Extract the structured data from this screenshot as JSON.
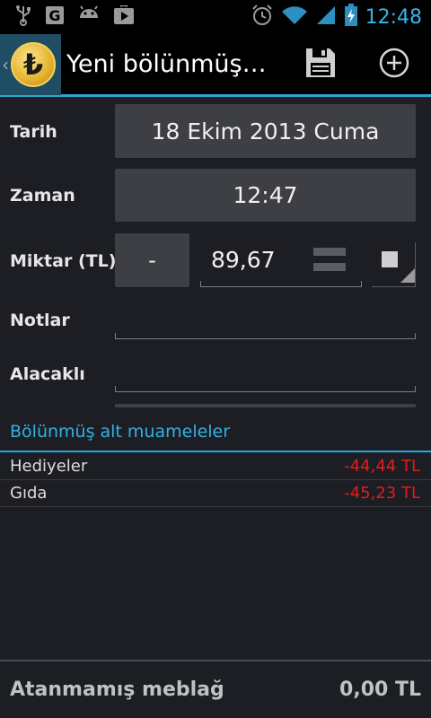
{
  "status_bar": {
    "time": "12:48",
    "icons": [
      "usb-icon",
      "g-icon",
      "android-icon",
      "play-store-icon",
      "alarm-icon",
      "wifi-icon",
      "signal-icon",
      "battery-charging-icon"
    ]
  },
  "action_bar": {
    "title": "Yeni bölünmüş…",
    "app_icon_glyph": "₺",
    "actions": [
      "save-icon",
      "add-icon"
    ]
  },
  "form": {
    "date_label": "Tarih",
    "date_value": "18 Ekim 2013 Cuma",
    "time_label": "Zaman",
    "time_value": "12:47",
    "amount_label": "Miktar (TL)",
    "amount_sign": "-",
    "amount_value": "89,67",
    "notes_label": "Notlar",
    "notes_value": "",
    "payee_label": "Alacaklı",
    "payee_value": ""
  },
  "splits": {
    "title": "Bölünmüş alt muameleler",
    "items": [
      {
        "name": "Hediyeler",
        "amount": "-44,44 TL"
      },
      {
        "name": "Gıda",
        "amount": "-45,23 TL"
      }
    ]
  },
  "footer": {
    "label": "Atanmamış meblağ",
    "value": "0,00 TL"
  },
  "colors": {
    "accent": "#2ea3d6",
    "negative": "#e21d1d",
    "clock": "#36b6e6"
  }
}
